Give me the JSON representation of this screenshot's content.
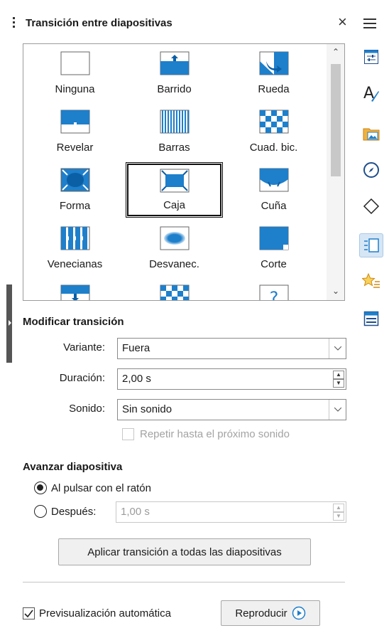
{
  "panel": {
    "title": "Transición entre diapositivas",
    "close_glyph": "×"
  },
  "deck": {
    "icons": [
      "properties-icon",
      "styles-icon",
      "gallery-icon",
      "navigator-icon",
      "shapes-icon",
      "slide-transition-icon",
      "animation-icon",
      "master-slides-icon"
    ],
    "active": "slide-transition-icon"
  },
  "transitions": {
    "items": [
      {
        "label": "Ninguna",
        "icon": "none"
      },
      {
        "label": "Barrido",
        "icon": "wipe"
      },
      {
        "label": "Rueda",
        "icon": "wheel"
      },
      {
        "label": "Revelar",
        "icon": "uncover"
      },
      {
        "label": "Barras",
        "icon": "bars"
      },
      {
        "label": "Cuad. bic.",
        "icon": "checkers"
      },
      {
        "label": "Forma",
        "icon": "shape"
      },
      {
        "label": "Caja",
        "icon": "box"
      },
      {
        "label": "Cuña",
        "icon": "wedge"
      },
      {
        "label": "Venecianas",
        "icon": "venetian"
      },
      {
        "label": "Desvanec.",
        "icon": "fade"
      },
      {
        "label": "Corte",
        "icon": "cut"
      },
      {
        "label": "",
        "icon": "push"
      },
      {
        "label": "",
        "icon": "checkers"
      },
      {
        "label": "",
        "icon": "random"
      }
    ],
    "selected": "Caja"
  },
  "modify": {
    "heading": "Modificar transición",
    "variant_label": "Variante:",
    "variant_value": "Fuera",
    "duration_label": "Duración:",
    "duration_value": "2,00 s",
    "sound_label": "Sonido:",
    "sound_value": "Sin sonido",
    "loop_label": "Repetir hasta el próximo sonido"
  },
  "advance": {
    "heading": "Avanzar diapositiva",
    "on_click_label": "Al pulsar con el ratón",
    "after_label": "Después:",
    "after_value": "1,00 s",
    "apply_all": "Aplicar transición a todas las diapositivas"
  },
  "footer": {
    "auto_preview_label": "Previsualización automática",
    "play_label": "Reproducir"
  },
  "colors": {
    "accent": "#1e7fcb",
    "accent_dark": "#0b5fa5"
  }
}
